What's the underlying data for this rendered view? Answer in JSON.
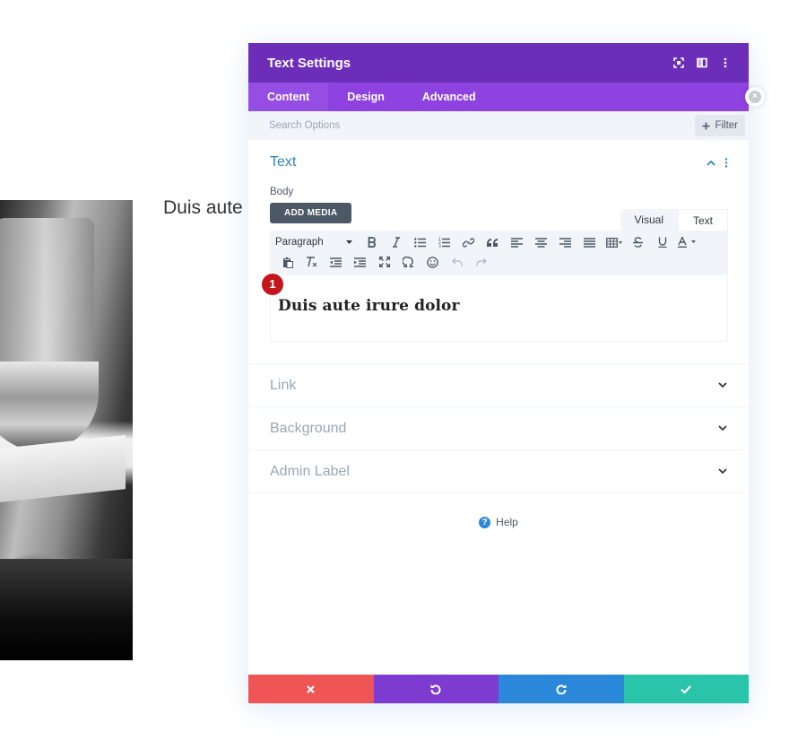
{
  "background": {
    "text_snippet": "Duis aute"
  },
  "modal": {
    "title": "Text Settings",
    "header_icons": [
      "expand-icon",
      "split-view-icon",
      "more-vertical-icon"
    ],
    "tabs": [
      {
        "label": "Content",
        "active": true
      },
      {
        "label": "Design",
        "active": false
      },
      {
        "label": "Advanced",
        "active": false
      }
    ],
    "search": {
      "placeholder": "Search Options",
      "filter_label": "Filter"
    },
    "text_section": {
      "title": "Text",
      "body_label": "Body",
      "add_media_label": "ADD MEDIA",
      "view_tabs": [
        {
          "label": "Visual",
          "active": false
        },
        {
          "label": "Text",
          "active": true
        }
      ],
      "format_select": "Paragraph",
      "badge": "1",
      "content": "Duis aute irure dolor"
    },
    "collapsed_sections": [
      {
        "label": "Link"
      },
      {
        "label": "Background"
      },
      {
        "label": "Admin Label"
      }
    ],
    "help_label": "Help",
    "footer_colors": {
      "cancel": "#ef5555",
      "undo": "#7e3bd0",
      "redo": "#2b87da",
      "save": "#29c4a9"
    }
  },
  "colors": {
    "header": "#6c2eb9",
    "tabs": "#8e42e0",
    "badge": "#c4151c"
  }
}
